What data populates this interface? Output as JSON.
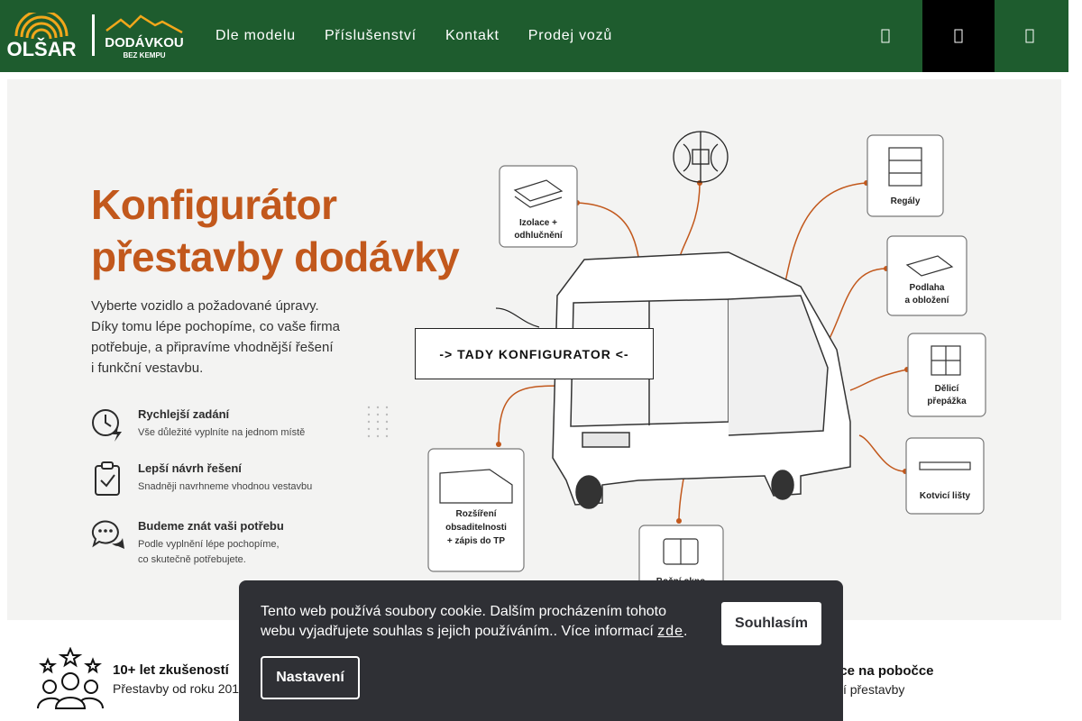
{
  "brand": {
    "name": "OLŠAR",
    "sub_name": "DODÁVKOU",
    "sub_tagline": "BEZ KEMPU",
    "header_color": "#1e5c2e",
    "accent_color": "#c2581c",
    "logo_gold": "#f2a71b"
  },
  "nav": {
    "items": [
      "Dle modelu",
      "Příslušenství",
      "Kontakt",
      "Prodej vozů"
    ]
  },
  "header_icons": {
    "search": "search-icon",
    "cart": "cart-icon",
    "menu": "menu-icon"
  },
  "hero": {
    "title_line1": "Konfigurátor",
    "title_line2": "přestavby dodávky",
    "desc_lines": [
      "Vyberte vozidlo a požadované úpravy.",
      "Díky tomu lépe pochopíme, co vaše firma",
      "potřebuje, a připravíme vhodnější řešení",
      "i funkční vestavbu."
    ],
    "features": [
      {
        "title": "Rychlejší zadání",
        "desc": [
          "Vše důležité vyplníte na jednom místě"
        ],
        "icon": "clock-lightning-icon"
      },
      {
        "title": "Lepší návrh řešení",
        "desc": [
          "Snadněji navrhneme vhodnou vestavbu"
        ],
        "icon": "clipboard-check-icon"
      },
      {
        "title": "Budeme znát vaši potřebu",
        "desc": [
          "Podle vyplnění lépe pochopíme,",
          "co skutečně potřebujete."
        ],
        "icon": "chat-bubbles-icon"
      }
    ],
    "diagram_labels": {
      "insulation": [
        "Izolace +",
        "odhlučnění"
      ],
      "shelves": [
        "Regály"
      ],
      "floor": [
        "Podlaha",
        "a obložení"
      ],
      "partition": [
        "Dělicí",
        "přepážka"
      ],
      "lashing": [
        "Kotvicí lišty"
      ],
      "seats": [
        "Rozšíření",
        "obsaditelnosti",
        "+ zápis do TP"
      ],
      "window": [
        "Boční okno"
      ]
    },
    "cta_label": "-> TADY KONFIGURATOR <-"
  },
  "trust": [
    {
      "title": "10+ let zkušeností",
      "desc": "Přestavby od roku 2014",
      "icon": "team-stars-icon"
    },
    {
      "title": "Konzultace na pobočce",
      "desc": "Individuální přestavby",
      "icon": "location-icon"
    }
  ],
  "cookie": {
    "text": "Tento web používá soubory cookie. Dalším procházením tohoto webu vyjadřujete souhlas s jejich používáním.. Více informací ",
    "link": "zde",
    "suffix": ".",
    "agree": "Souhlasím",
    "settings": "Nastavení"
  }
}
